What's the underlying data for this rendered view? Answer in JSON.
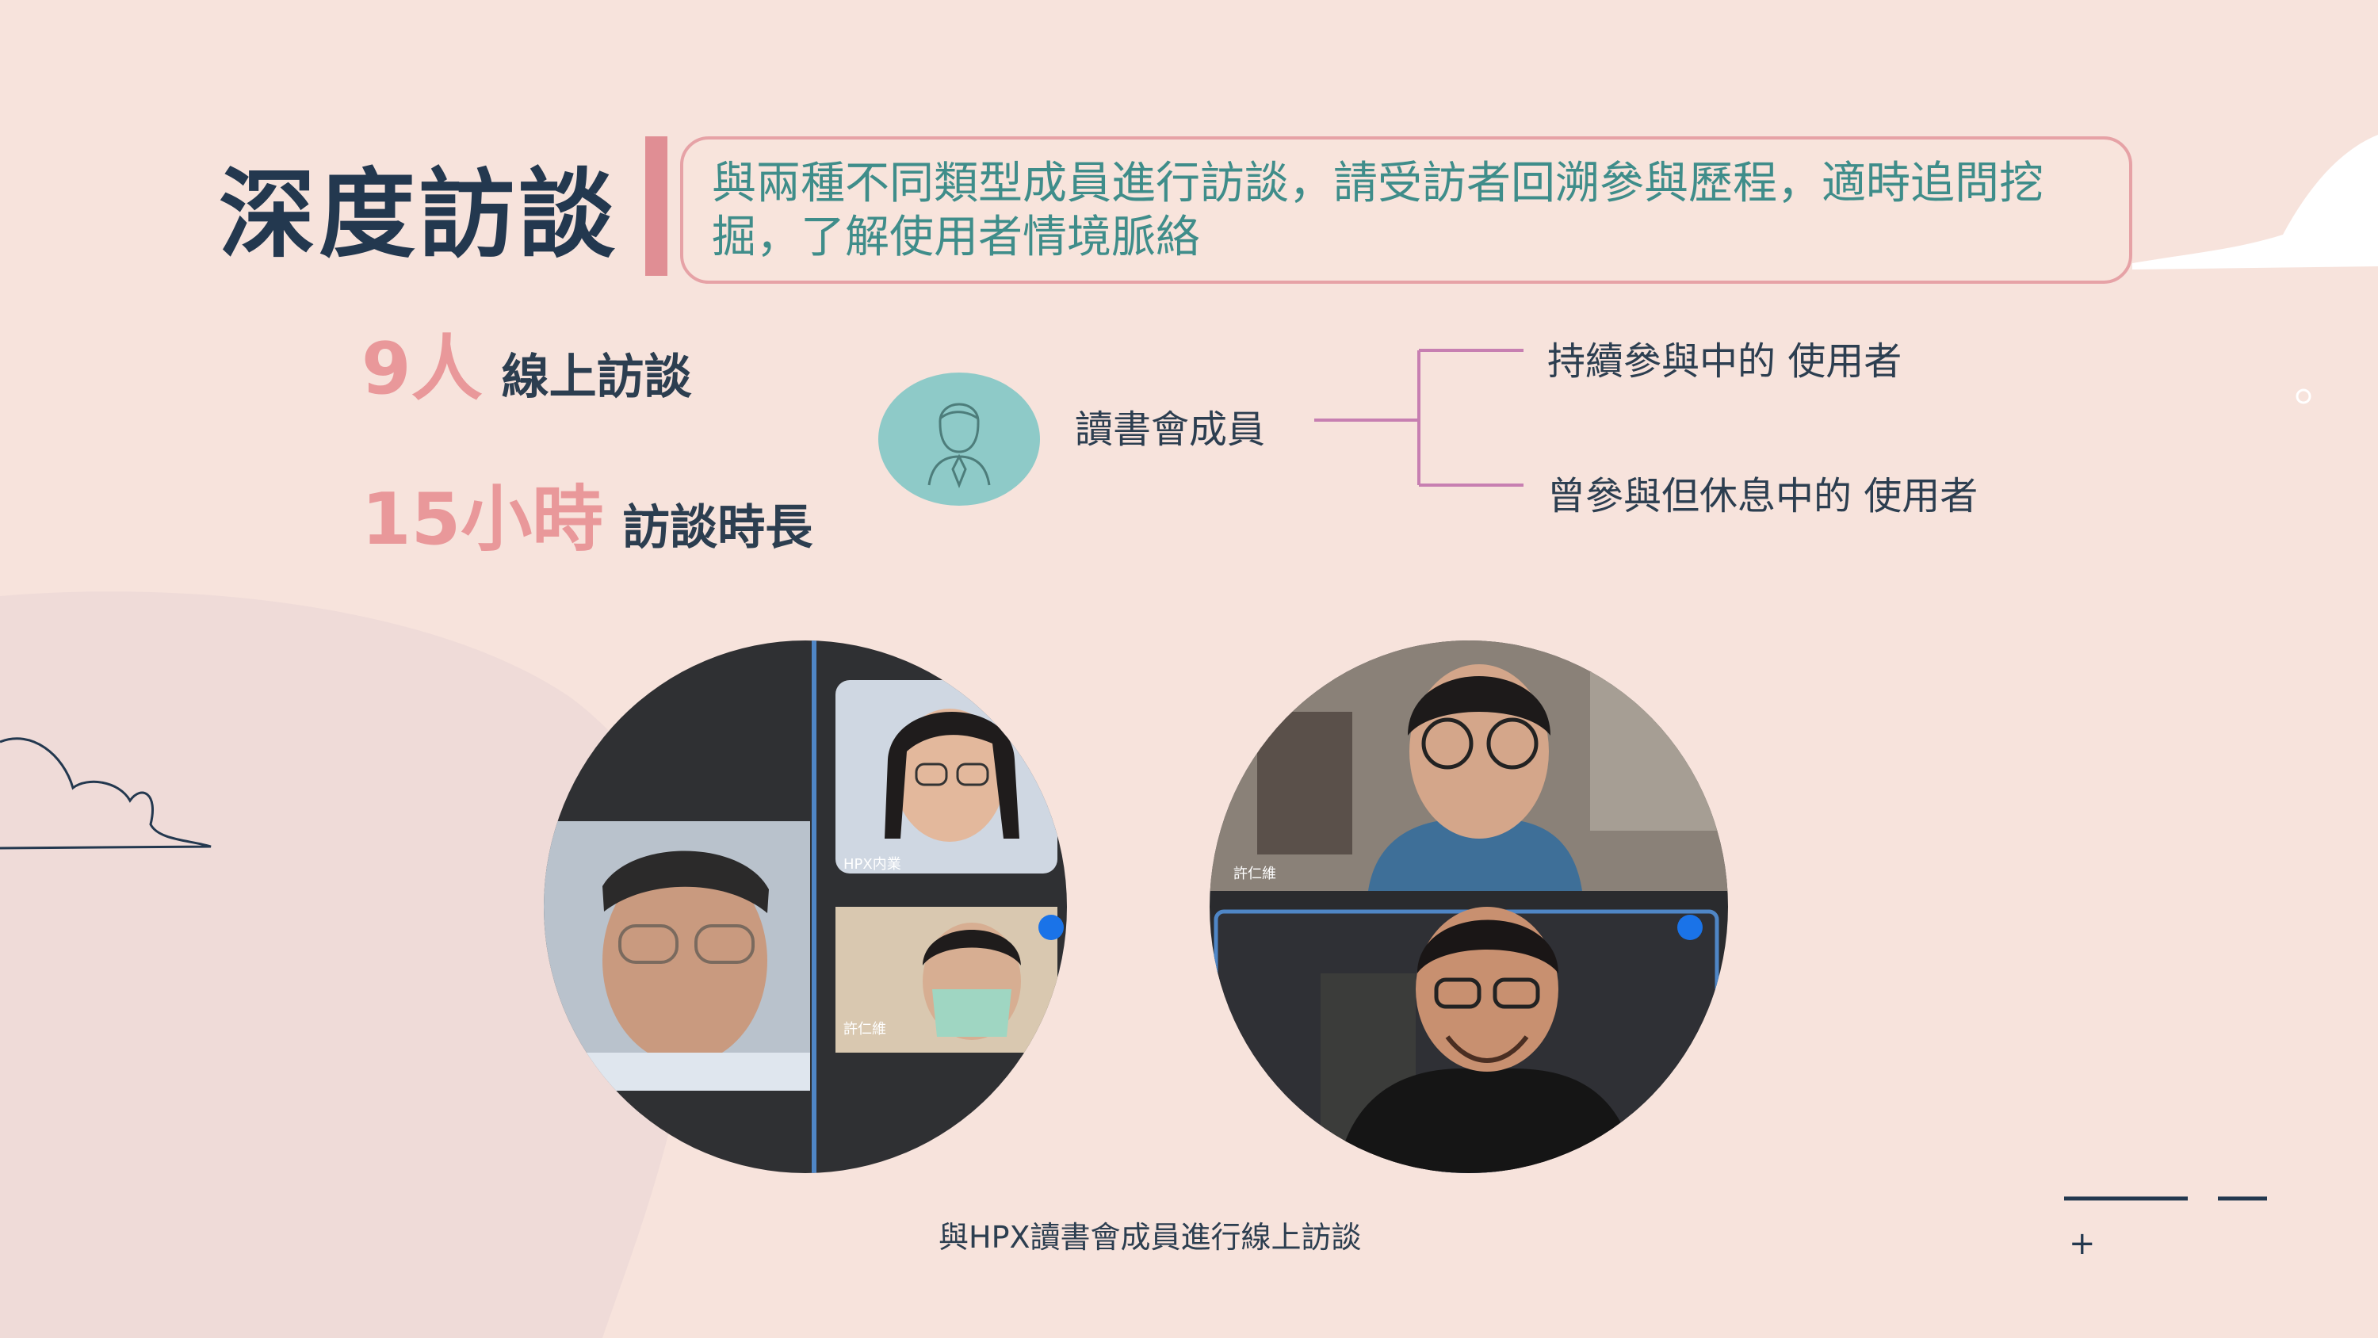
{
  "title": "深度訪談",
  "description": "與兩種不同類型成員進行訪談，請受訪者回溯參與歷程，適時追問挖掘，了解使用者情境脈絡",
  "stats": [
    {
      "big": "9人",
      "label": "線上訪談"
    },
    {
      "big": "15小時",
      "label": "訪談時長"
    }
  ],
  "diagram": {
    "root": "讀書會成員",
    "branches": [
      "持續參與中的 使用者",
      "曾參與但休息中的 使用者"
    ]
  },
  "photo_names": {
    "left_top": "HPX内業",
    "left_bottom": "許仁維",
    "right_top": "許仁維"
  },
  "caption": "與HPX讀書會成員進行線上訪談",
  "decor_plus": "+",
  "colors": {
    "background": "#f7e3dc",
    "title": "#23384f",
    "accent_pink": "#e08e94",
    "teal": "#8ecac8",
    "description_text": "#3f8d8a",
    "branch_line": "#c77fb1",
    "stat_number": "#e9989a"
  },
  "icons": [
    "user-avatar-icon",
    "cloud-outline-icon",
    "speaking-indicator-icon"
  ]
}
